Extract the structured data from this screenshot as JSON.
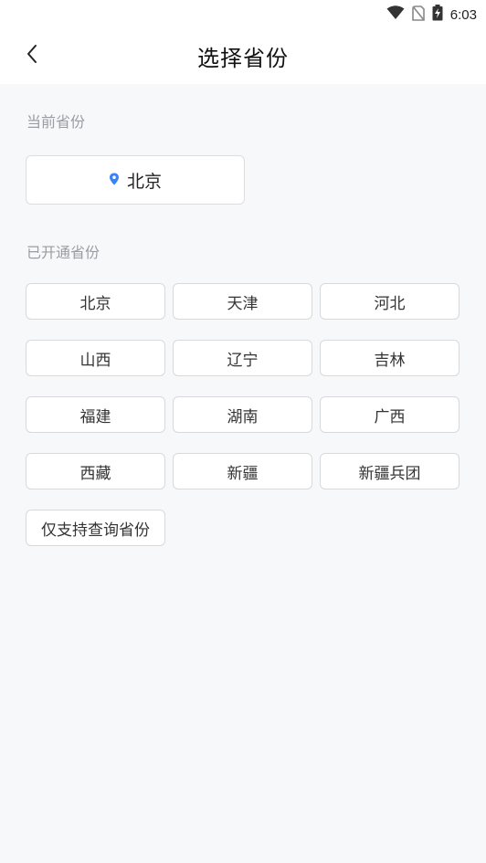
{
  "status_bar": {
    "time": "6:03",
    "icons": [
      "wifi-icon",
      "no-sim-icon",
      "battery-charging-icon"
    ]
  },
  "header": {
    "title": "选择省份",
    "back_icon": "chevron-left-icon"
  },
  "current_section": {
    "label": "当前省份",
    "province": "北京",
    "location_icon": "location-pin-icon",
    "accent_color": "#3b82f6"
  },
  "opened_section": {
    "label": "已开通省份",
    "provinces": [
      "北京",
      "天津",
      "河北",
      "山西",
      "辽宁",
      "吉林",
      "福建",
      "湖南",
      "广西",
      "西藏",
      "新疆",
      "新疆兵团",
      "仅支持查询省份"
    ]
  }
}
